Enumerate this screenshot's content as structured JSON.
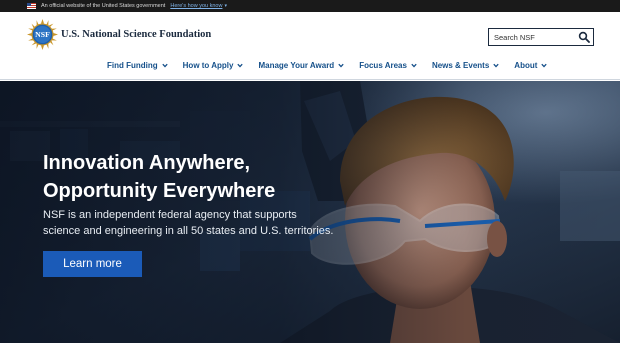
{
  "gov_banner": {
    "text": "An official website of the United States government",
    "link": "Here's how you know",
    "flag_icon": "us-flag-icon"
  },
  "header": {
    "org_name": "U.S. National Science Foundation",
    "logo_text": "NSF",
    "logo_icon": "nsf-seal-logo",
    "search": {
      "placeholder": "Search NSF",
      "icon": "search-icon"
    }
  },
  "nav": {
    "items": [
      {
        "label": "Find Funding"
      },
      {
        "label": "How to Apply"
      },
      {
        "label": "Manage Your Award"
      },
      {
        "label": "Focus Areas"
      },
      {
        "label": "News & Events"
      },
      {
        "label": "About"
      }
    ],
    "caret_icon": "chevron-down-icon"
  },
  "hero": {
    "title_line1": "Innovation Anywhere,",
    "title_line2": "Opportunity Everywhere",
    "desc_line1": "NSF is an independent federal agency that supports",
    "desc_line2": "science and engineering in all 50 states and U.S. territories.",
    "button_label": "Learn more"
  },
  "colors": {
    "gov_banner_bg": "#1a1a1a",
    "nav_link": "#15508a",
    "primary_button": "#1b5bb8",
    "org_name": "#1b2a3e"
  }
}
